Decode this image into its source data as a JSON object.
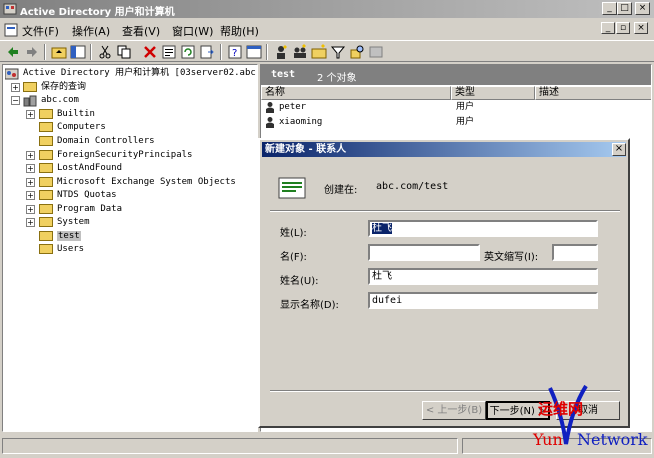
{
  "window": {
    "title": "Active Directory 用户和计算机",
    "controls": {
      "minimize": "_",
      "maximize": "□",
      "close": "×"
    }
  },
  "menu": {
    "items": [
      "文件(F)",
      "操作(A)",
      "查看(V)",
      "窗口(W)",
      "帮助(H)"
    ],
    "mdi_controls": {
      "minimize": "_",
      "restore": "▫",
      "close": "×"
    }
  },
  "toolbar": {
    "icons": [
      "back-icon",
      "forward-icon",
      "up-folder-icon",
      "show-tree-icon",
      "cut-icon",
      "copy-icon",
      "delete-icon",
      "properties-icon",
      "refresh-icon",
      "export-icon",
      "help-icon",
      "mmc-icon",
      "new-user-icon",
      "new-group-icon",
      "new-ou-icon",
      "filter-icon",
      "find-icon",
      "group-policy-icon"
    ]
  },
  "tree": {
    "root": "Active Directory 用户和计算机 [03server02.abc",
    "saved_queries": "保存的查询",
    "domain": "abc.com",
    "children": [
      "Builtin",
      "Computers",
      "Domain Controllers",
      "ForeignSecurityPrincipals",
      "LostAndFound",
      "Microsoft Exchange System Objects",
      "NTDS Quotas",
      "Program Data",
      "System",
      "test",
      "Users"
    ]
  },
  "right_pane": {
    "container": "test",
    "object_count": "2 个对象",
    "columns": [
      "名称",
      "类型",
      "描述"
    ],
    "rows": [
      {
        "name": "peter",
        "type": "用户",
        "description": ""
      },
      {
        "name": "xiaoming",
        "type": "用户",
        "description": ""
      }
    ]
  },
  "dialog": {
    "title": "新建对象 - 联系人",
    "create_in_label": "创建在:",
    "create_in_value": "abc.com/test",
    "fields": {
      "last_name": {
        "label": "姓(L):",
        "value": "杜飞"
      },
      "first_name": {
        "label": "名(F):",
        "value": ""
      },
      "initials": {
        "label": "英文缩写(I):",
        "value": ""
      },
      "full_name": {
        "label": "姓名(U):",
        "value": "杜飞"
      },
      "display_name": {
        "label": "显示名称(D):",
        "value": "dufei"
      }
    },
    "buttons": {
      "back": "< 上一步(B)",
      "next": "下一步(N) >",
      "cancel": "取消"
    }
  },
  "watermark": {
    "chinese": "运维网",
    "left": "Yun",
    "right": "Network"
  }
}
